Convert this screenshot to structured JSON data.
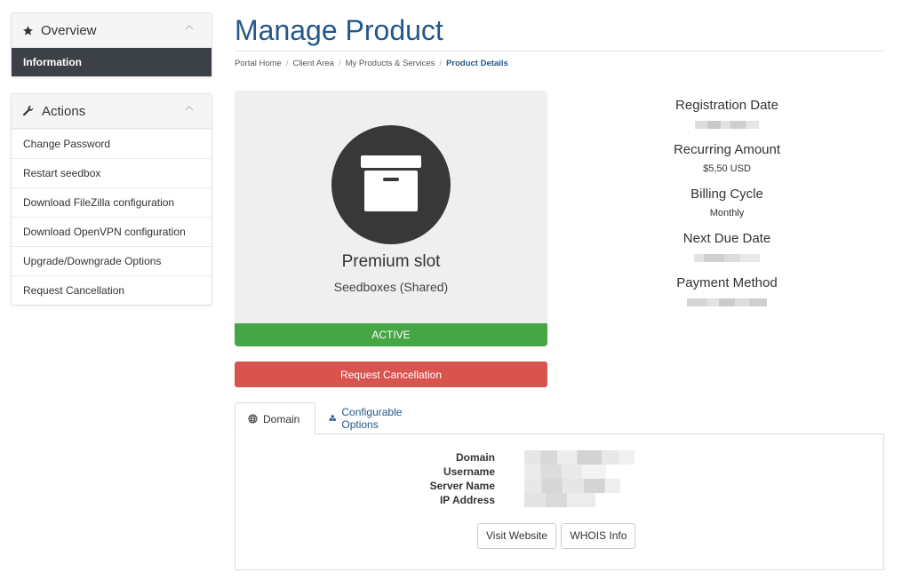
{
  "sidebar": {
    "overview": {
      "title": "Overview",
      "icon": "star-icon",
      "active_item": "Information"
    },
    "actions": {
      "title": "Actions",
      "icon": "wrench-icon",
      "items": [
        "Change Password",
        "Restart seedbox",
        "Download FileZilla configuration",
        "Download OpenVPN configuration",
        "Upgrade/Downgrade Options",
        "Request Cancellation"
      ]
    }
  },
  "page": {
    "title": "Manage Product",
    "breadcrumb": [
      "Portal Home",
      "Client Area",
      "My Products & Services",
      "Product Details"
    ],
    "breadcrumb_separator": "/"
  },
  "product": {
    "icon": "archive-box-icon",
    "name": "Premium slot",
    "group": "Seedboxes (Shared)",
    "status": "ACTIVE",
    "cancel_label": "Request Cancellation"
  },
  "details": {
    "registration_date_label": "Registration Date",
    "recurring_amount_label": "Recurring Amount",
    "recurring_amount_value": "$5,50 USD",
    "billing_cycle_label": "Billing Cycle",
    "billing_cycle_value": "Monthly",
    "next_due_date_label": "Next Due Date",
    "payment_method_label": "Payment Method"
  },
  "tabs": {
    "domain": {
      "label": "Domain",
      "icon": "globe-icon"
    },
    "configurable": {
      "label": "Configurable Options",
      "icon": "cubes-icon"
    }
  },
  "domain_panel": {
    "labels": [
      "Domain",
      "Username",
      "Server Name",
      "IP Address"
    ],
    "visit_website": "Visit Website",
    "whois_info": "WHOIS Info"
  },
  "colors": {
    "title_blue": "#24588b",
    "active_dark": "#3b4146",
    "status_green": "#46a646",
    "cancel_red": "#d9534f"
  }
}
